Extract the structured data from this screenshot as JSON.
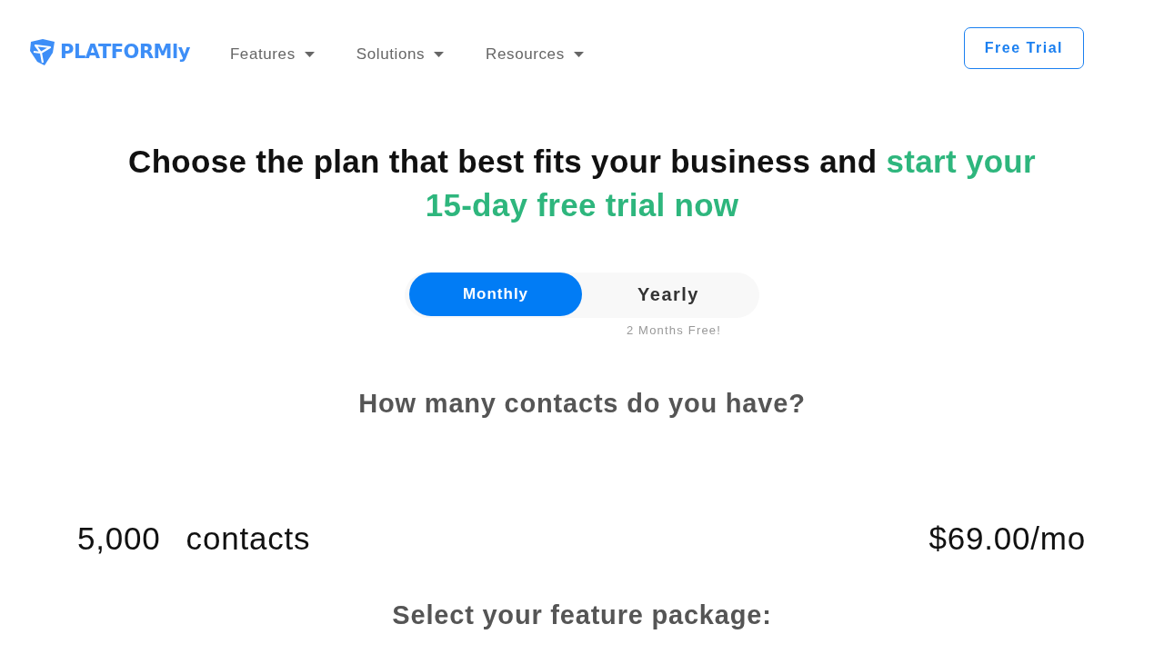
{
  "brand": {
    "name": "PLATFORMly"
  },
  "nav": {
    "items": [
      {
        "label": "Features",
        "has_menu": true
      },
      {
        "label": "Solutions",
        "has_menu": true
      },
      {
        "label": "Resources",
        "has_menu": true
      }
    ],
    "cta": "Free Trial"
  },
  "heading": {
    "text": "Choose the plan that best fits your business and",
    "highlight": "start your 15-day free trial now"
  },
  "billing": {
    "options": [
      {
        "label": "Monthly",
        "selected": true
      },
      {
        "label": "Yearly",
        "selected": false,
        "note": "2 Months Free!"
      }
    ]
  },
  "contacts": {
    "question": "How many contacts do you have?",
    "count": "5,000",
    "unit": "contacts",
    "price": "$69.00/mo"
  },
  "packages": {
    "title": "Select your feature package:"
  }
}
